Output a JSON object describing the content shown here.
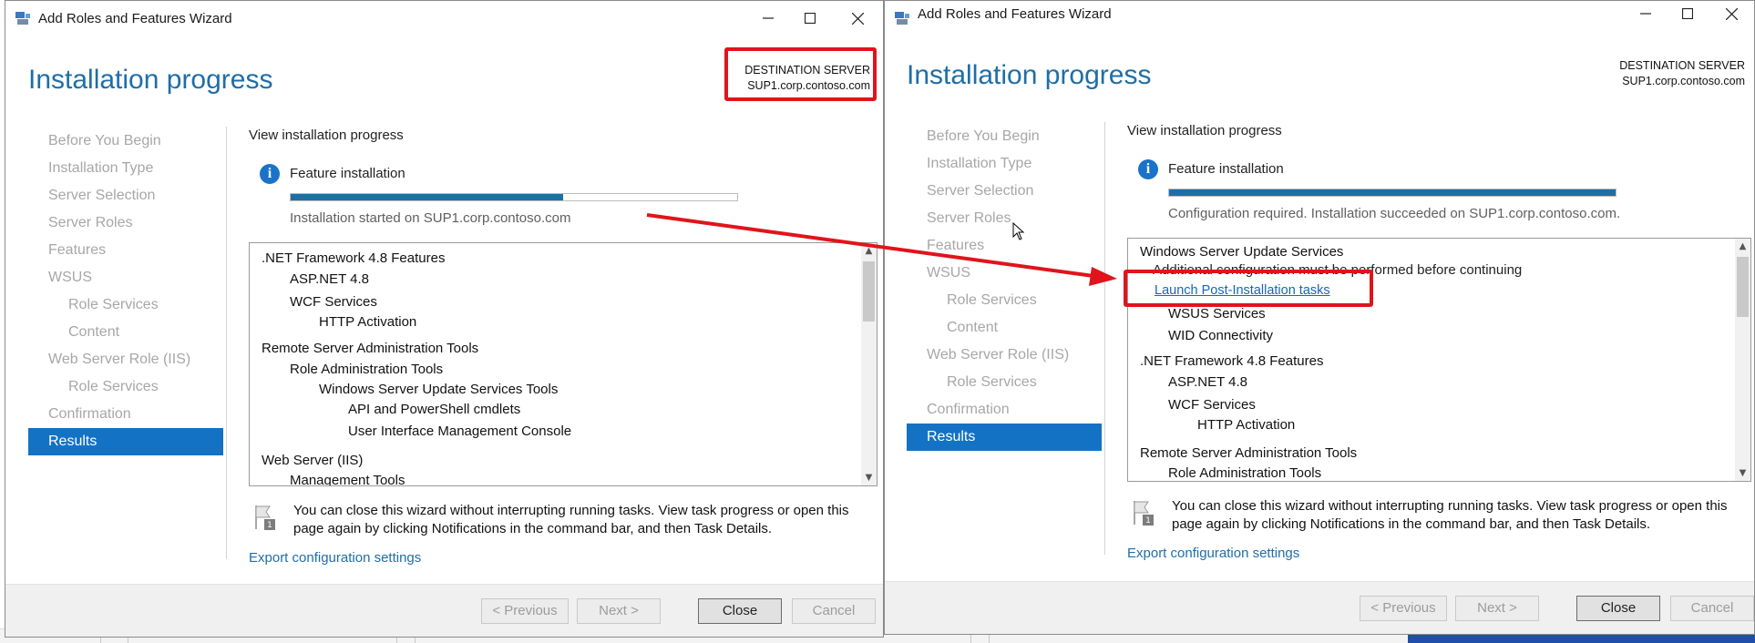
{
  "left_window": {
    "title": "Add Roles and Features Wizard",
    "heading": "Installation progress",
    "destination_label": "DESTINATION SERVER",
    "destination_server": "SUP1.corp.contoso.com",
    "nav": [
      "Before You Begin",
      "Installation Type",
      "Server Selection",
      "Server Roles",
      "Features",
      "WSUS",
      "Role Services",
      "Content",
      "Web Server Role (IIS)",
      "Role Services",
      "Confirmation",
      "Results"
    ],
    "view_progress_label": "View installation progress",
    "feature_installation_label": "Feature installation",
    "progress_fraction": 0.61,
    "status_text": "Installation started on SUP1.corp.contoso.com",
    "results": [
      ".NET Framework 4.8 Features",
      "ASP.NET 4.8",
      "WCF Services",
      "HTTP Activation",
      "Remote Server Administration Tools",
      "Role Administration Tools",
      "Windows Server Update Services Tools",
      "API and PowerShell cmdlets",
      "User Interface Management Console",
      "Web Server (IIS)",
      "Management Tools"
    ],
    "note": "You can close this wizard without interrupting running tasks. View task progress or open this page again by clicking Notifications in the command bar, and then Task Details.",
    "export_link": "Export configuration settings",
    "buttons": {
      "previous": "< Previous",
      "next": "Next >",
      "close": "Close",
      "cancel": "Cancel"
    }
  },
  "right_window": {
    "title": "Add Roles and Features Wizard",
    "heading": "Installation progress",
    "destination_label": "DESTINATION SERVER",
    "destination_server": "SUP1.corp.contoso.com",
    "nav": [
      "Before You Begin",
      "Installation Type",
      "Server Selection",
      "Server Roles",
      "Features",
      "WSUS",
      "Role Services",
      "Content",
      "Web Server Role (IIS)",
      "Role Services",
      "Confirmation",
      "Results"
    ],
    "view_progress_label": "View installation progress",
    "feature_installation_label": "Feature installation",
    "progress_fraction": 1.0,
    "status_text": "Configuration required. Installation succeeded on SUP1.corp.contoso.com.",
    "results": {
      "wsus": "Windows Server Update Services",
      "additional_config": "Additional configuration must be performed before continuing",
      "launch_link": "Launch Post-Installation tasks",
      "wsus_services": "WSUS Services",
      "wid": "WID Connectivity",
      "netfx": ".NET Framework 4.8 Features",
      "aspnet": "ASP.NET 4.8",
      "wcf": "WCF Services",
      "http": "HTTP Activation",
      "rsat": "Remote Server Administration Tools",
      "rat": "Role Administration Tools"
    },
    "note": "You can close this wizard without interrupting running tasks. View task progress or open this page again by clicking Notifications in the command bar, and then Task Details.",
    "export_link": "Export configuration settings",
    "buttons": {
      "previous": "< Previous",
      "next": "Next >",
      "close": "Close",
      "cancel": "Cancel"
    }
  },
  "icons": {
    "app": "wizard-app-icon",
    "minimize": "minimize-icon",
    "maximize": "maximize-icon",
    "close": "close-icon",
    "info": "info-icon",
    "flag": "notification-flag-icon",
    "cursor": "mouse-pointer-icon"
  },
  "colors": {
    "heading_blue": "#1e6ea8",
    "nav_active": "#1472c4",
    "progress_fill": "#1d6fa5",
    "link_blue": "#1565c0",
    "annotation_red": "#e0141b"
  }
}
